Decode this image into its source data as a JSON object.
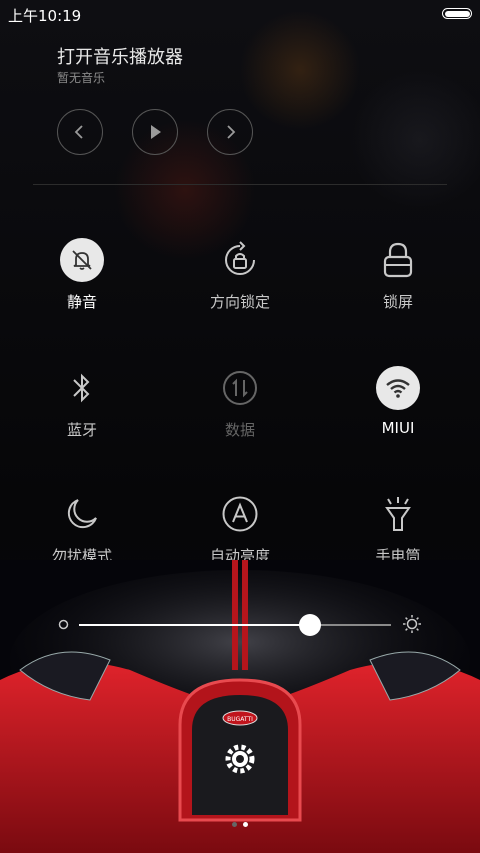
{
  "status_bar": {
    "time": "上午10:19"
  },
  "music": {
    "title": "打开音乐播放器",
    "subtitle": "暂无音乐"
  },
  "toggles": [
    {
      "label": "静音",
      "icon": "silent-bell-icon",
      "state": "on"
    },
    {
      "label": "方向锁定",
      "icon": "rotation-lock-icon",
      "state": "off"
    },
    {
      "label": "锁屏",
      "icon": "lock-icon",
      "state": "off"
    },
    {
      "label": "蓝牙",
      "icon": "bluetooth-icon",
      "state": "off"
    },
    {
      "label": "数据",
      "icon": "mobile-data-icon",
      "state": "disabled"
    },
    {
      "label": "MIUI",
      "icon": "wifi-icon",
      "state": "on"
    },
    {
      "label": "勿扰模式",
      "icon": "moon-icon",
      "state": "off"
    },
    {
      "label": "自动亮度",
      "icon": "auto-brightness-icon",
      "state": "off"
    },
    {
      "label": "手电筒",
      "icon": "flashlight-icon",
      "state": "off"
    }
  ],
  "brightness": {
    "level_fraction": 0.74
  },
  "car": {
    "badge": "BUGATTI"
  },
  "pager": {
    "pages": 2,
    "active": 2
  },
  "colors": {
    "toggle_on_bg": "#e8e8e8",
    "accent_red": "#c0141c"
  }
}
